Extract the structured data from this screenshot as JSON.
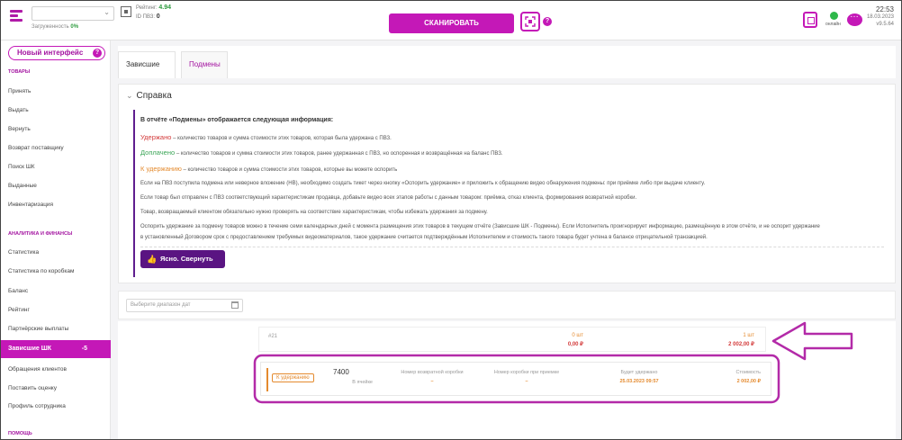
{
  "header": {
    "load_label": "Загруженность",
    "load_value": "0%",
    "rating_label": "Рейтинг:",
    "rating_value": "4.94",
    "pvz_label": "ID ПВЗ:",
    "pvz_value": "0",
    "scan_label": "СКАНИРОВАТЬ",
    "help_glyph": "?",
    "online_label": "онлайн",
    "time": "22:53",
    "date": "18.03.2023",
    "version": "v9.5.64"
  },
  "sidebar": {
    "new_ui_label": "Новый интерфейс",
    "new_ui_help": "?",
    "section_goods": "ТОВАРЫ",
    "items_goods": [
      "Принять",
      "Выдать",
      "Вернуть",
      "Возврат поставщику",
      "Поиск ШК",
      "Выданные",
      "Инвентаризация"
    ],
    "section_analytics": "АНАЛИТИКА И ФИНАНСЫ",
    "items_analytics": [
      "Статистика",
      "Статистика по коробкам",
      "Баланс",
      "Рейтинг",
      "Партнёрские выплаты"
    ],
    "active_item": "Зависшие ШК",
    "active_count": "-5",
    "items_after": [
      "Обращения клиентов",
      "Поставить оценку",
      "Профиль сотрудника"
    ],
    "section_help": "ПОМОЩЬ"
  },
  "tabs": {
    "tab1": "Зависшие ШК",
    "tab2": "Подмены"
  },
  "help": {
    "title": "Справка",
    "intro": "В отчёте «Подмены» отображается следующая информация:",
    "l1_key": "Удержано",
    "l1_text": " – количество товаров и сумма стоимости этих товаров, которая была удержана с ПВЗ.",
    "l2_key": "Доплачено",
    "l2_text": " – количество товаров и сумма стоимости этих товаров, ранее удержанная с ПВЗ, но оспоренная и возвращённая на баланс ПВЗ.",
    "l3_key": "К удержанию",
    "l3_text": " – количество товаров и сумма стоимости этих товаров, которые вы можете оспорить",
    "l4": "Если на ПВЗ поступила подмена или неверное вложение (НВ), необходимо создать тикет через кнопку «Оспорить удержание» и приложить к обращению видео обнаружения подмены: при приёмке либо при выдаче клиенту.",
    "l5": "Если товар был отправлен с ПВЗ соответствующий характеристикам продавца, добавьте видео всех этапов работы с данным товаром: приёмка, отказ клиента, формирования возвратной коробки.",
    "l6": "Товар, возвращаемый клиентом обязательно нужно проверять на соответствие характеристикам, чтобы избежать удержания за подмену.",
    "l7": "Оспорить удержание за подмену товаров можно в течение семи календарных дней с момента размещения этих товаров в текущем отчёте (Зависшие ШК - Подмены). Если Исполнитель проигнорирует информацию, размещённую в этом отчёте, и не оспорит удержание",
    "l8": "в установленный Договором срок с предоставлением требуемых видеоматериалов, такое удержание считается подтверждённым Исполнителем и стоимость такого товара будет учтена в балансе отрицательной транзакцией.",
    "ack_label": "Ясно. Свернуть"
  },
  "filter": {
    "date_placeholder": "Выберите диапазон дат"
  },
  "summary": {
    "number": "#21",
    "col1_qty": "0 шт",
    "col1_sum": "0,00 ₽",
    "col2_qty": "1 шт",
    "col2_sum": "2 002,00 ₽"
  },
  "detail": {
    "badge": "К удержанию",
    "id": "7400",
    "cell": "В ячейке",
    "h_return_box": "Номер возвратной коробки",
    "v_return_box": "–",
    "h_accept_box": "Номер коробки при приемке",
    "v_accept_box": "–",
    "h_will_hold": "Будет удержано",
    "v_will_hold": "25.03.2023 09:57",
    "h_cost": "Стоимость",
    "v_cost": "2 002,00 ₽"
  },
  "colors": {
    "accent": "#c418b7",
    "deep_purple": "#5a1482",
    "annotation": "#b32aa8",
    "orange": "#e48a2e",
    "red": "#d33a3a",
    "green": "#3aa556"
  },
  "icons": [
    "menu-logo-icon",
    "chevron-down-icon",
    "qr-icon",
    "scan-frame-icon",
    "help-icon",
    "magnifier-icon",
    "online-status-icon",
    "chat-icon",
    "calendar-icon",
    "thumb-up-icon"
  ]
}
